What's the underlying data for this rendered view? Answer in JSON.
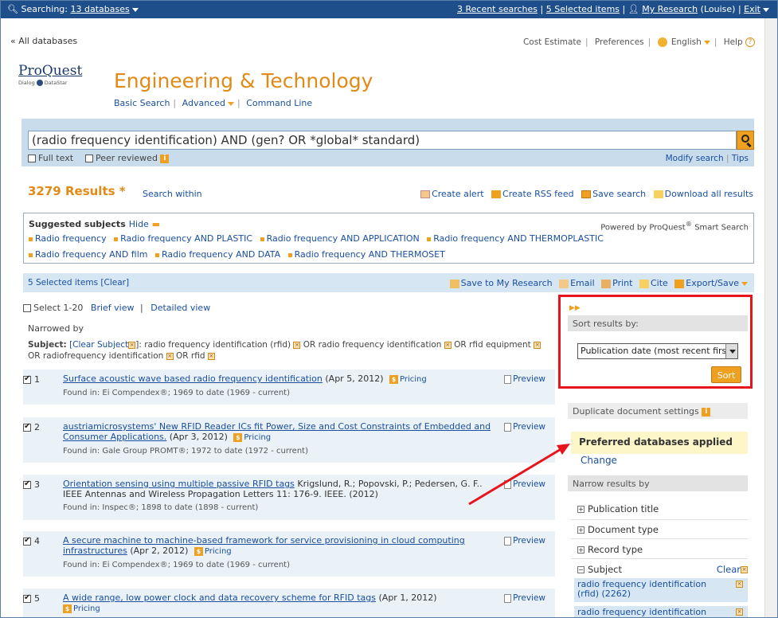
{
  "topbar": {
    "searching_label": "Searching:",
    "databases_link": "13 databases",
    "recent_searches": "3 Recent searches",
    "sep": "|",
    "selected_items": "5 Selected items",
    "my_research": "My Research",
    "user": "(Louise)",
    "exit": "Exit"
  },
  "nav": {
    "all_databases": "« All databases",
    "cost_estimate": "Cost Estimate",
    "preferences": "Preferences",
    "language": "English",
    "help": "Help"
  },
  "logo": {
    "name": "ProQuest",
    "sub1": "Dialog",
    "sub2": "DataStar"
  },
  "title": "Engineering & Technology",
  "search_links": {
    "basic": "Basic Search",
    "advanced": "Advanced",
    "command": "Command Line"
  },
  "search": {
    "query": "(radio frequency identification) AND (gen? OR *global* standard)",
    "full_text": "Full text",
    "peer_reviewed": "Peer reviewed",
    "modify": "Modify search",
    "tips": "Tips"
  },
  "results_header": {
    "count": "3279 Results *",
    "search_within": "Search within",
    "create_alert": "Create alert",
    "create_rss": "Create RSS feed",
    "save_search": "Save search",
    "download_all": "Download all results"
  },
  "suggested": {
    "heading": "Suggested subjects",
    "hide": "Hide",
    "powered": "Powered by ProQuest",
    "powered_tail": " Smart Search",
    "line1": [
      "Radio frequency",
      "Radio frequency AND PLASTIC",
      "Radio frequency AND APPLICATION",
      "Radio frequency AND THERMOPLASTIC"
    ],
    "line2": [
      "Radio frequency AND film",
      "Radio frequency AND DATA",
      "Radio frequency AND THERMOSET"
    ]
  },
  "selbar": {
    "selected": "5 Selected items [Clear]",
    "save_to": "Save to My Research",
    "email": "Email",
    "print": "Print",
    "cite": "Cite",
    "export": "Export/Save"
  },
  "view": {
    "select": "Select 1-20",
    "brief": "Brief view",
    "sep": "|",
    "detailed": "Detailed view"
  },
  "narrowed": "Narrowed by",
  "subject_filter": {
    "label": "Subject:",
    "clear": "[Clear Subject",
    "clear_end": "]:",
    "t1": "radio frequency identification (rfid)",
    "t2": "OR radio frequency identification",
    "t3": "OR rfid equipment",
    "t4": "OR radiofrequency identification",
    "t5": "OR rfid"
  },
  "results": [
    {
      "num": "1",
      "title": "Surface acoustic wave based radio frequency identification",
      "meta": " (Apr 5, 2012)",
      "pricing": "Pricing",
      "found": "Found in: Ei Compendex®; 1969 to date (1969 - current)",
      "preview": "Preview"
    },
    {
      "num": "2",
      "title": "austriamicrosystems' New RFID Reader ICs fit Power, Size and Cost Constraints of Embedded and Consumer Applications.",
      "meta": " (Apr 3, 2012)",
      "pricing": "Pricing",
      "found": "Found in: Gale Group PROMT®; 1972 to date (1972 - current)",
      "preview": "Preview"
    },
    {
      "num": "3",
      "title": "Orientation sensing using multiple passive RFID tags",
      "meta": " Krigslund, R.; Popovski, P.; Pedersen, G. F.. IEEE Antennas and Wireless Propagation Letters 11: 176-9. IEEE. (2012)",
      "pricing": "",
      "found": "Found in: Inspec®; 1898 to date (1898 - current)",
      "preview": "Preview"
    },
    {
      "num": "4",
      "title": "A secure machine to machine-based framework for service provisioning in cloud computing infrastructures",
      "meta": " (Apr 2, 2012)",
      "pricing": "Pricing",
      "found": "Found in: Ei Compendex®; 1969 to date (1969 - current)",
      "preview": "Preview"
    },
    {
      "num": "5",
      "title": "A wide range, low power clock and data recovery scheme for RFID tags",
      "meta": " (Apr 1, 2012)",
      "pricing": "Pricing",
      "found": "",
      "preview": "Preview"
    }
  ],
  "panel": {
    "sort_heading": "Sort results by:",
    "sort_value": "Publication date (most recent first)",
    "sort_button": "Sort",
    "dup_heading": "Duplicate document settings",
    "preferred": "Preferred databases applied",
    "change": "Change",
    "narrow_heading": "Narrow results by",
    "facets": [
      "Publication title",
      "Document type",
      "Record type",
      "Subject"
    ],
    "subject_clear": "Clear",
    "subject_items": [
      "radio frequency identification (rfid) (2262)",
      "radio frequency identification"
    ]
  },
  "colors": {
    "accent": "#e08a17",
    "topbar": "#1f4f8a",
    "link": "#1a4fa0",
    "highlight": "#e8141c"
  }
}
